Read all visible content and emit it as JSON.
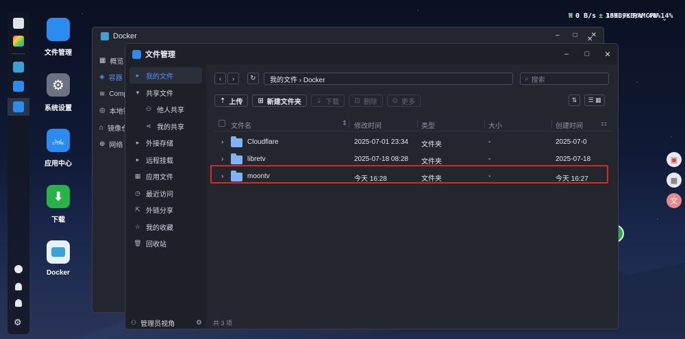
{
  "system_monitor": {
    "read_label": "R",
    "read_value": "0 B/s",
    "write_label": "W",
    "write_value": "0 B/s",
    "down_value": "339.9KB/s",
    "up_value": "16KB/s",
    "cpu_label": "CPU",
    "cpu_value": "14%",
    "ram_label": "RAM",
    "ram_value": "40%"
  },
  "desktop": {
    "icons": [
      {
        "label": "文件管理"
      },
      {
        "label": "系统设置"
      },
      {
        "label": "应用中心",
        "badge": "STORE"
      },
      {
        "label": "下载"
      },
      {
        "label": "Docker"
      }
    ]
  },
  "docker_window": {
    "title": "Docker",
    "menu": [
      "概览",
      "容器",
      "Comp",
      "本地镜",
      "镜像仓",
      "网络"
    ]
  },
  "file_manager": {
    "title": "文件管理",
    "sidebar": {
      "items": [
        "我的文件",
        "共享文件",
        "他人共享",
        "我的共享",
        "外接存储",
        "远程挂载",
        "应用文件",
        "最近访问",
        "外链分享",
        "我的收藏",
        "回收站"
      ],
      "footer": "管理员视角"
    },
    "path": "我的文件 › Docker",
    "search_placeholder": "搜索",
    "toolbar": {
      "upload": "上传",
      "new_folder": "新建文件夹",
      "download": "下载",
      "delete": "删除",
      "more": "更多"
    },
    "columns": {
      "name": "文件名",
      "modified": "修改时间",
      "type": "类型",
      "size": "大小",
      "created": "创建时间"
    },
    "rows": [
      {
        "name": "Cloudflare",
        "modified": "2025-07-01 23:34",
        "type": "文件夹",
        "size": "-",
        "created": "2025-07-0"
      },
      {
        "name": "libretv",
        "modified": "2025-07-18 08:28",
        "type": "文件夹",
        "size": "-",
        "created": "2025-07-18"
      },
      {
        "name": "moontv",
        "modified": "今天 16:28",
        "type": "文件夹",
        "size": "-",
        "created": "今天 16:27"
      }
    ],
    "footer": "共 3 项"
  },
  "colors": {
    "accent": "#4f8ef7",
    "highlight_border": "#e0271f",
    "folder": "#7fb3f5"
  }
}
